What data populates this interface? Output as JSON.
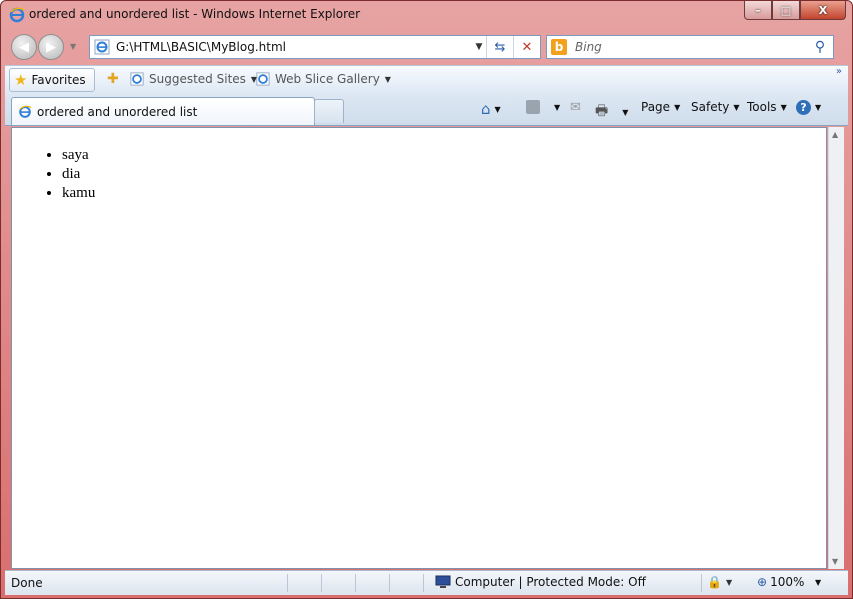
{
  "window": {
    "title": "ordered and unordered list - Windows Internet Explorer",
    "controls": {
      "minimize": "–",
      "maximize": "□",
      "close": "X"
    }
  },
  "navigation": {
    "address": "G:\\HTML\\BASIC\\MyBlog.html",
    "search_placeholder": "Bing"
  },
  "favorites_bar": {
    "favorites_label": "Favorites",
    "links": [
      {
        "label": "Suggested Sites"
      },
      {
        "label": "Web Slice Gallery"
      }
    ]
  },
  "tabs": [
    {
      "label": "ordered and unordered list"
    }
  ],
  "command_bar": {
    "page": "Page",
    "safety": "Safety",
    "tools": "Tools"
  },
  "page_content": {
    "list_items": [
      "saya",
      "dia",
      "kamu"
    ]
  },
  "status_bar": {
    "status": "Done",
    "zone": "Computer | Protected Mode: Off",
    "zoom": "100%"
  },
  "colors": {
    "frame": "#d96e6e",
    "accent": "#2a5ea8"
  }
}
